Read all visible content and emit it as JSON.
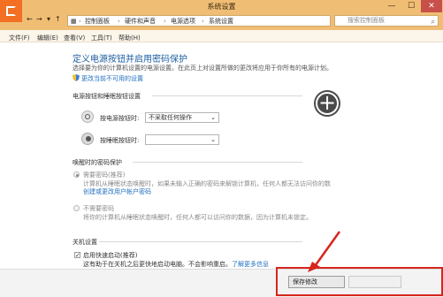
{
  "window": {
    "title": "系统设置",
    "controls": {
      "minimize": "—",
      "maximize": "☐",
      "close": "✕"
    }
  },
  "address_bar": {
    "nav": {
      "back": "←",
      "forward": "→",
      "dropdown": "▾",
      "up": "↑"
    },
    "breadcrumbs": [
      "控制面板",
      "硬件和声音",
      "电源选项",
      "系统设置"
    ],
    "separator": "›",
    "search_placeholder": "搜索控制面板",
    "search_icon": "⌕"
  },
  "menu": [
    "文件(F)",
    "编辑(E)",
    "查看(V)",
    "工具(T)",
    "帮助(H)"
  ],
  "page": {
    "title": "定义电源按钮并启用密码保护",
    "description": "选择要为你的计算机设置的电源设置。在此页上对设置所做的更改将应用于你所有的电源计划。",
    "change_unavailable_link": "更改当前不可用的设置",
    "power_section": {
      "heading": "电源按钮和睡眠按钮设置",
      "power_button_label": "按电源按钮时:",
      "power_button_value": "不采取任何操作",
      "sleep_button_label": "按睡眠按钮时:",
      "sleep_button_value": ""
    },
    "password_section": {
      "heading": "唤醒时的密码保护",
      "option1_title": "需要密码(推荐)",
      "option1_desc": "计算机从睡眠状态唤醒时，如果未输入正确的密码来解锁计算机，任何人都无法访问你的数",
      "option1_desc2": "据。",
      "option1_link": "创建或更改用户帐户密码",
      "option2_title": "不需要密码",
      "option2_desc": "将你的计算机从睡眠状态唤醒时，任何人都可以访问你的数据，因为计算机未锁定。"
    },
    "shutdown_section": {
      "heading": "关机设置",
      "fast_startup_label": "启用快速启动(推荐)",
      "fast_startup_checked": "✓",
      "fast_startup_desc": "这有助于在关机之后更快地启动电脑。不会影响重启。",
      "learn_more": "了解更多信息"
    }
  },
  "footer": {
    "save_label": "保存修改"
  },
  "overlay": {
    "plus_symbol": "+"
  },
  "colors": {
    "titlebar": "#f0bd74",
    "link": "#1f6fbf",
    "title_blue": "#1b5ea0",
    "highlight_red": "#d7261d"
  }
}
